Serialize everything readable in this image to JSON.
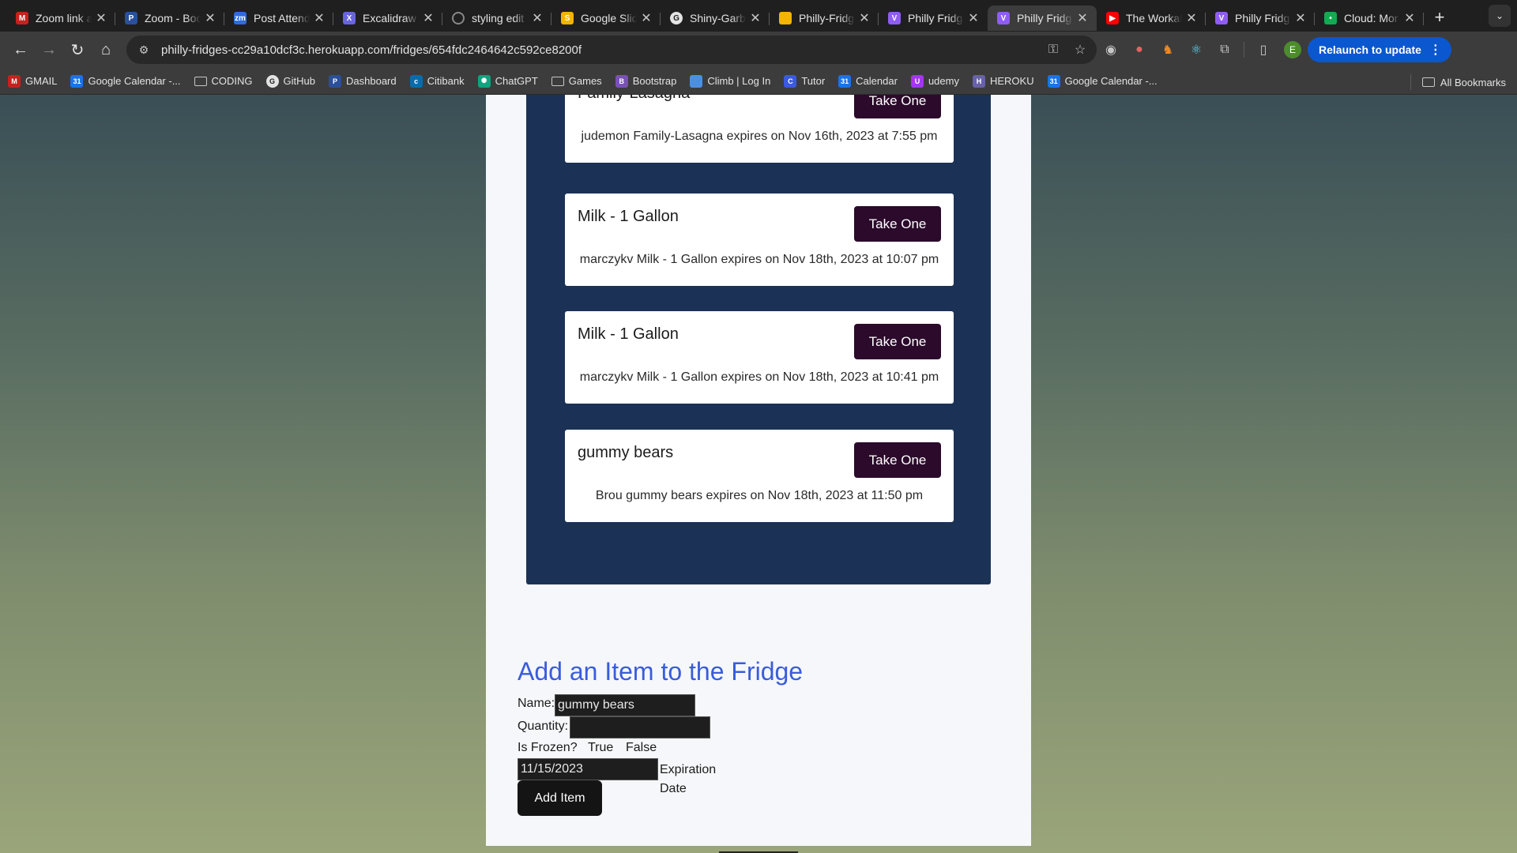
{
  "tabs": [
    {
      "title": "Zoom link a",
      "icon": "gmail-icon",
      "color": "#c5221f",
      "glyph": "M"
    },
    {
      "title": "Zoom - Boo",
      "icon": "penn-shield-icon",
      "color": "#2b4f9c",
      "glyph": "P"
    },
    {
      "title": "Post Attend",
      "icon": "zoom-icon",
      "color": "#2d6cdf",
      "glyph": "zm"
    },
    {
      "title": "Excalidraw",
      "icon": "excalidraw-icon",
      "color": "#6965db",
      "glyph": "X"
    },
    {
      "title": "styling edit",
      "icon": "loading-icon",
      "color": "#888888",
      "glyph": ""
    },
    {
      "title": "Google Slid",
      "icon": "slides-icon",
      "color": "#f4b400",
      "glyph": "S"
    },
    {
      "title": "Shiny-Garb",
      "icon": "github-icon",
      "color": "#e3e3e3",
      "glyph": "G"
    },
    {
      "title": "Philly-Fridg",
      "icon": "slides-icon",
      "color": "#f4b400",
      "glyph": ""
    },
    {
      "title": "Philly Fridg",
      "icon": "vite-icon",
      "color": "#8f5df5",
      "glyph": "V"
    },
    {
      "title": "Philly Fridg",
      "icon": "vite-icon",
      "color": "#8f5df5",
      "glyph": "V",
      "active": true
    },
    {
      "title": "The Workal",
      "icon": "youtube-icon",
      "color": "#ff0000",
      "glyph": "▶"
    },
    {
      "title": "Philly Fridg",
      "icon": "vite-icon",
      "color": "#8f5df5",
      "glyph": "V"
    },
    {
      "title": "Cloud: Mor",
      "icon": "mongodb-icon",
      "color": "#13aa52",
      "glyph": "•"
    }
  ],
  "toolbar": {
    "url": "philly-fridges-cc29a10dcf3c.herokuapp.com/fridges/654fdc2464642c592ce8200f",
    "relaunch_label": "Relaunch to update",
    "profile_initial": "E"
  },
  "bookmarks": [
    {
      "label": "GMAIL",
      "icon": "gmail-icon",
      "color": "#c5221f",
      "glyph": "M"
    },
    {
      "label": "Google Calendar -...",
      "icon": "calendar-icon",
      "color": "#1a73e8",
      "glyph": "31"
    },
    {
      "label": "CODING",
      "icon": "folder-icon",
      "folder": true
    },
    {
      "label": "GitHub",
      "icon": "github-icon",
      "color": "#e3e3e3",
      "glyph": "G"
    },
    {
      "label": "Dashboard",
      "icon": "penn-shield-icon",
      "color": "#2b4f9c",
      "glyph": "P"
    },
    {
      "label": "Citibank",
      "icon": "citibank-icon",
      "color": "#056dae",
      "glyph": "c"
    },
    {
      "label": "ChatGPT",
      "icon": "chatgpt-icon",
      "color": "#10a37f",
      "glyph": "✺"
    },
    {
      "label": "Games",
      "icon": "folder-icon",
      "folder": true
    },
    {
      "label": "Bootstrap",
      "icon": "bootstrap-icon",
      "color": "#7952b3",
      "glyph": "B"
    },
    {
      "label": "Climb | Log In",
      "icon": "climb-icon",
      "color": "#4a90e2",
      "glyph": ""
    },
    {
      "label": "Tutor",
      "icon": "tutor-icon",
      "color": "#3b5bdb",
      "glyph": "C"
    },
    {
      "label": "Calendar",
      "icon": "calendar-icon",
      "color": "#1a73e8",
      "glyph": "31"
    },
    {
      "label": "udemy",
      "icon": "udemy-icon",
      "color": "#a435f0",
      "glyph": "U"
    },
    {
      "label": "HEROKU",
      "icon": "heroku-icon",
      "color": "#6762a6",
      "glyph": "H"
    },
    {
      "label": "Google Calendar -...",
      "icon": "calendar-icon",
      "color": "#1a73e8",
      "glyph": "31"
    }
  ],
  "all_bookmarks_label": "All Bookmarks",
  "items": [
    {
      "name": "Family-Lasagna",
      "button": "Take One",
      "description": "judemon Family-Lasagna expires on Nov 16th, 2023 at 7:55 pm"
    },
    {
      "name": "Milk - 1 Gallon",
      "button": "Take One",
      "description": "marczykv Milk - 1 Gallon expires on Nov 18th, 2023 at 10:07 pm"
    },
    {
      "name": "Milk - 1 Gallon",
      "button": "Take One",
      "description": "marczykv Milk - 1 Gallon expires on Nov 18th, 2023 at 10:41 pm"
    },
    {
      "name": "gummy bears",
      "button": "Take One",
      "description": "Brou gummy bears expires on Nov 18th, 2023 at 11:50 pm"
    }
  ],
  "form": {
    "title": "Add an Item to the Fridge",
    "name_label": "Name:",
    "name_value": "gummy bears",
    "quantity_label": "Quantity:",
    "quantity_value": "",
    "frozen_label": "Is Frozen?",
    "frozen_true": "True",
    "frozen_false": "False",
    "date_value": "11/15/2023",
    "date_label_line1": "Expiration",
    "date_label_line2": "Date",
    "submit_label": "Add Item"
  },
  "colors": {
    "fridge_panel": "#1b3256",
    "take_button": "#2b0a2b",
    "form_title": "#3a5cdb",
    "relaunch_button": "#0b57d0"
  }
}
